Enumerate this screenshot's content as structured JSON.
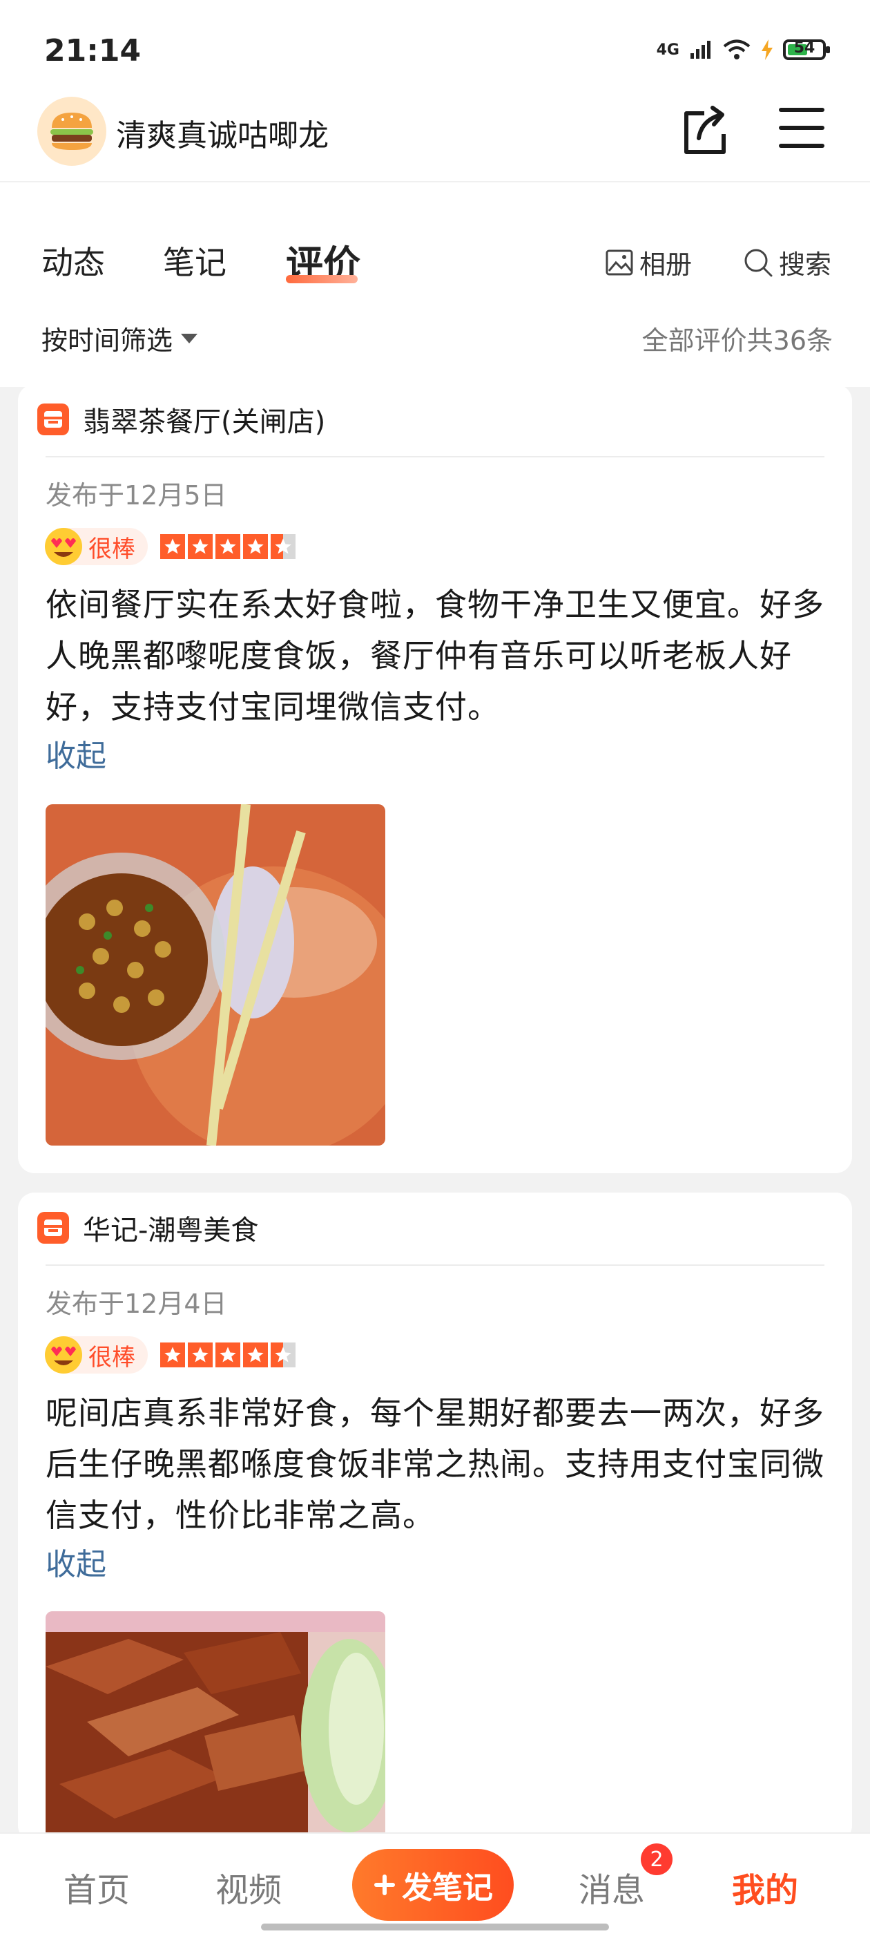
{
  "status_bar": {
    "time": "21:14",
    "network": "4G",
    "battery": "54"
  },
  "header": {
    "username": "清爽真诚咕唧龙",
    "avatar_icon": "burger-icon",
    "share_icon": "share-icon",
    "menu_icon": "menu-icon"
  },
  "tabs": [
    {
      "label": "动态",
      "active": false
    },
    {
      "label": "笔记",
      "active": false
    },
    {
      "label": "评价",
      "active": true
    }
  ],
  "tools": {
    "album": "相册",
    "search": "搜索"
  },
  "filter": {
    "label": "按时间筛选",
    "total": "全部评价共36条"
  },
  "reviews": [
    {
      "shop": "翡翠茶餐厅(关闸店)",
      "date": "发布于12月5日",
      "badge": "很棒",
      "stars": 4.5,
      "text": "依间餐厅实在系太好食啦，食物干净卫生又便宜。好多人晚黑都嚟呢度食饭，餐厅仲有音乐可以听老板人好好，支持支付宝同埋微信支付。",
      "collapse": "收起",
      "photo": "soup-photo"
    },
    {
      "shop": "华记-潮粤美食",
      "date": "发布于12月4日",
      "badge": "很棒",
      "stars": 4.5,
      "text": "呢间店真系非常好食，每个星期好都要去一两次，好多后生仔晚黑都喺度食饭非常之热闹。支持用支付宝同微信支付，性价比非常之高。",
      "collapse": "收起",
      "photo": "roast-goose-photo"
    }
  ],
  "bottom_nav": {
    "home": "首页",
    "video": "视频",
    "publish": "发笔记",
    "messages": "消息",
    "messages_badge": "2",
    "me": "我的"
  },
  "colors": {
    "accent": "#ff4d1f",
    "link": "#3f6c9a",
    "star": "#ff5d2a"
  }
}
